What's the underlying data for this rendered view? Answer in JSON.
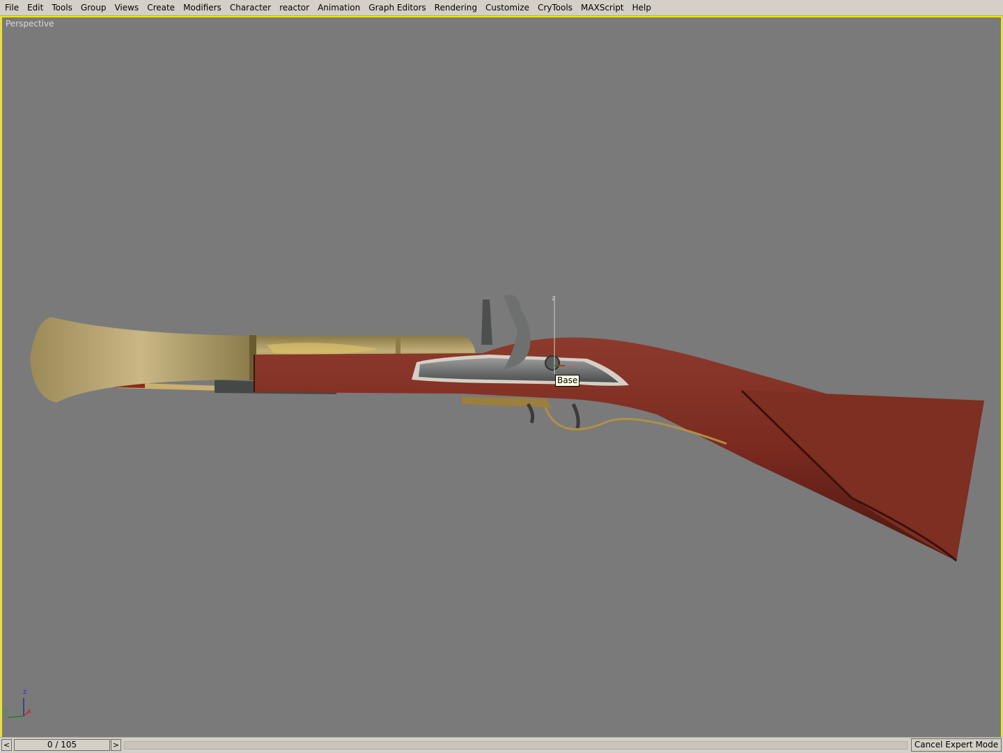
{
  "menu": [
    "File",
    "Edit",
    "Tools",
    "Group",
    "Views",
    "Create",
    "Modifiers",
    "Character",
    "reactor",
    "Animation",
    "Graph Editors",
    "Rendering",
    "Customize",
    "CryTools",
    "MAXScript",
    "Help"
  ],
  "viewport": {
    "label": "Perspective",
    "gizmo_label": "Base",
    "gizmo_axis_label": "z",
    "border_color": "#f0e800",
    "background": "#7a7a7a",
    "model": "flintlock-blunderbuss"
  },
  "axis_tripod": {
    "z": "z",
    "y": "y",
    "x": "x"
  },
  "timeline": {
    "prev_label": "<",
    "next_label": ">",
    "frame_display": "0 / 105"
  },
  "cancel_expert_label": "Cancel Expert Mode",
  "colors": {
    "wood": "#7a2a1f",
    "brass": "#a58e55",
    "steel": "#6f7272",
    "highlight": "#f0e800"
  }
}
